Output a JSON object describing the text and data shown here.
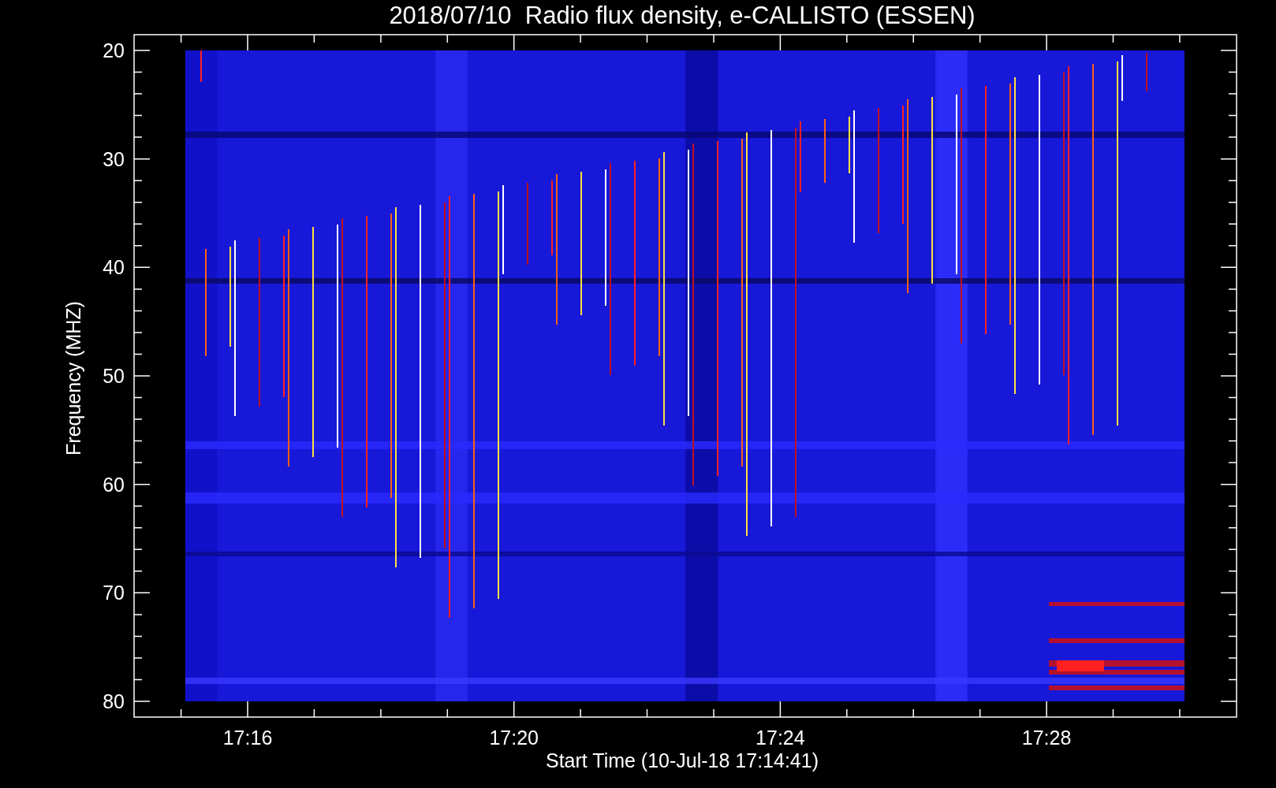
{
  "title": "2018/07/10  Radio flux density, e-CALLISTO (ESSEN)",
  "y_axis": {
    "label": "Frequency (MHZ)",
    "ticks": [
      "20",
      "30",
      "40",
      "50",
      "60",
      "70",
      "80"
    ]
  },
  "x_axis": {
    "label": "Start Time (10-Jul-18 17:14:41)",
    "ticks": [
      "17:16",
      "17:20",
      "17:24",
      "17:28"
    ]
  }
}
